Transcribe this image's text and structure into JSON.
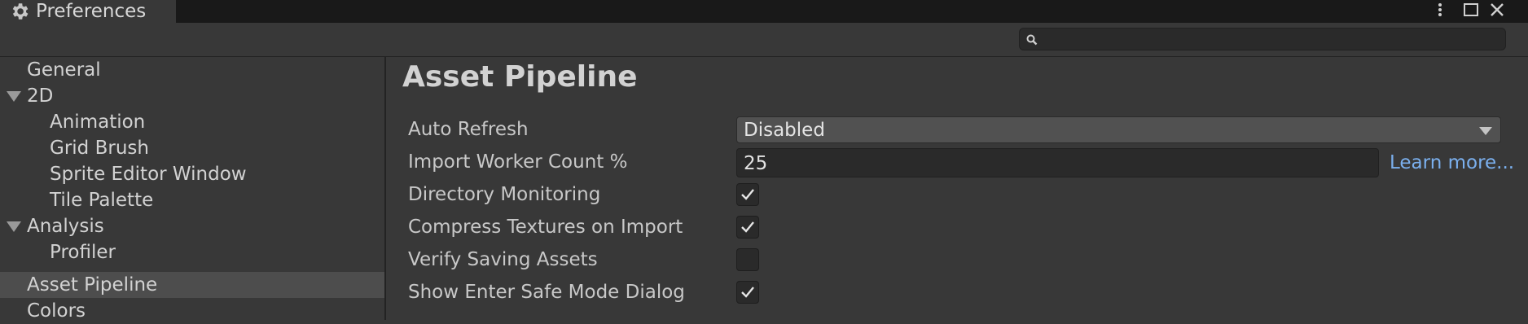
{
  "window": {
    "title": "Preferences",
    "icons": {
      "tab": "gear-icon",
      "menu": "kebab-menu-icon",
      "maximize": "maximize-icon",
      "close": "close-icon"
    }
  },
  "search": {
    "placeholder": "",
    "value": "",
    "icon": "search-icon"
  },
  "sidebar": {
    "items": [
      {
        "label": "General"
      },
      {
        "label": "2D"
      },
      {
        "label": "Animation"
      },
      {
        "label": "Grid Brush"
      },
      {
        "label": "Sprite Editor Window"
      },
      {
        "label": "Tile Palette"
      },
      {
        "label": "Analysis"
      },
      {
        "label": "Profiler"
      },
      {
        "label": "Asset Pipeline"
      },
      {
        "label": "Colors"
      }
    ],
    "selected": "Asset Pipeline"
  },
  "main": {
    "heading": "Asset Pipeline",
    "auto_refresh": {
      "label": "Auto Refresh",
      "value": "Disabled"
    },
    "import_worker": {
      "label": "Import Worker Count %",
      "value": "25",
      "link": "Learn more..."
    },
    "directory_monitoring": {
      "label": "Directory Monitoring",
      "checked": true
    },
    "compress_textures": {
      "label": "Compress Textures on Import",
      "checked": true
    },
    "verify_saving": {
      "label": "Verify Saving Assets",
      "checked": false
    },
    "safe_mode_dialog": {
      "label": "Show Enter Safe Mode Dialog",
      "checked": true
    }
  },
  "colors": {
    "background": "#383838",
    "link": "#7bb0ee",
    "selected": "#4d4d4d"
  }
}
